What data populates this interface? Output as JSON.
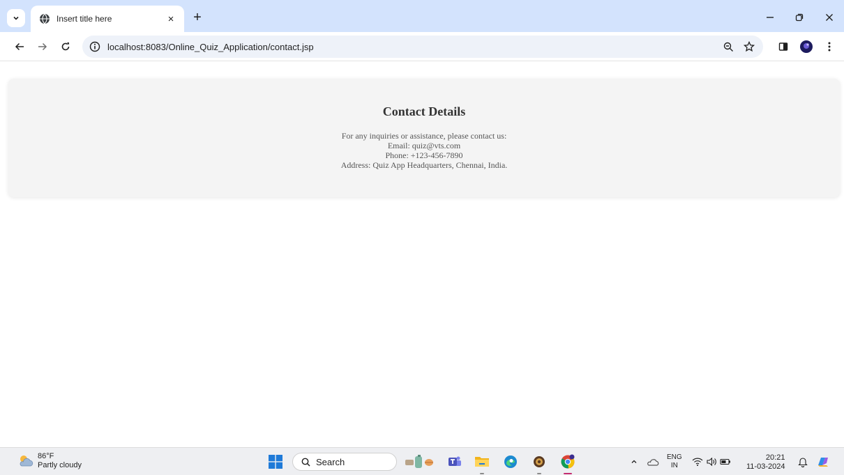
{
  "browser": {
    "tab_title": "Insert title here",
    "tab_close_glyph": "×",
    "new_tab_glyph": "+",
    "url": "localhost:8083/Online_Quiz_Application/contact.jsp"
  },
  "page": {
    "heading": "Contact Details",
    "lines": [
      "For any inquiries or assistance, please contact us:",
      "Email: quiz@vts.com",
      "Phone: +123-456-7890",
      "Address: Quiz App Headquarters, Chennai, India."
    ]
  },
  "taskbar": {
    "weather_temp": "86°F",
    "weather_desc": "Partly cloudy",
    "search_label": "Search",
    "lang_top": "ENG",
    "lang_bottom": "IN",
    "time": "20:21",
    "date": "11-03-2024"
  },
  "colors": {
    "tabstrip": "#d3e3fd",
    "omnibox": "#eef2f9",
    "card": "#f4f4f4",
    "taskbar": "#eeeff2"
  }
}
